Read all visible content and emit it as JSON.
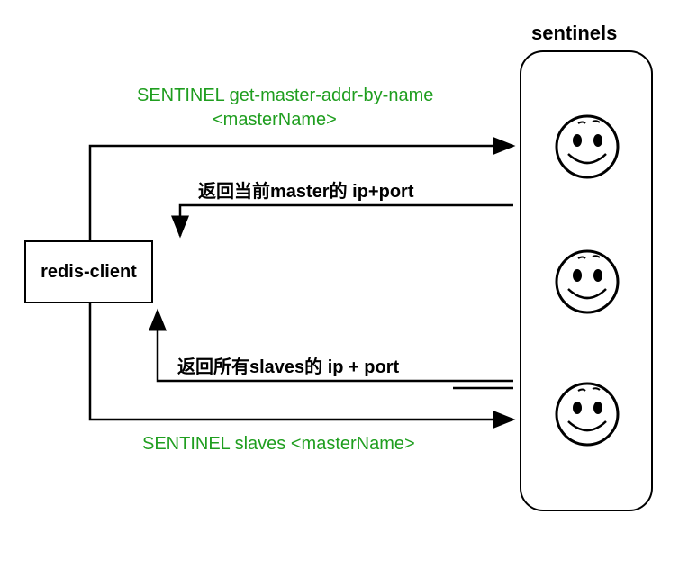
{
  "title": "sentinels",
  "client": {
    "label": "redis-client"
  },
  "commands": {
    "get_master_line1": "SENTINEL get-master-addr-by-name",
    "get_master_line2": "<masterName>",
    "slaves": "SENTINEL slaves <masterName>"
  },
  "responses": {
    "master_ip_port": "返回当前master的 ip+port",
    "slaves_ip_port": "返回所有slaves的 ip + port"
  },
  "faces": [
    {
      "id": "sentinel-1"
    },
    {
      "id": "sentinel-2"
    },
    {
      "id": "sentinel-3"
    }
  ]
}
